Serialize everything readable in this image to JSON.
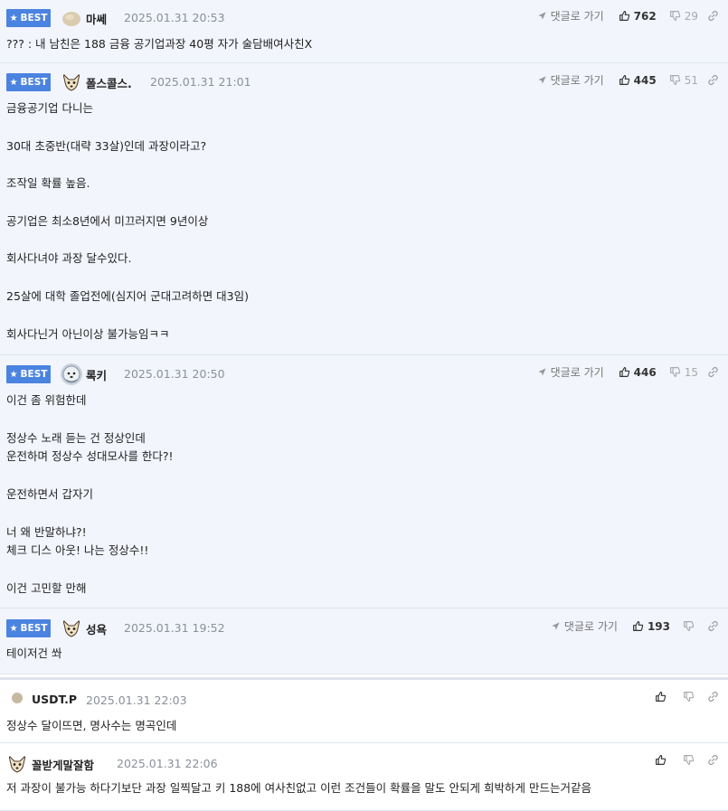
{
  "best_label": "BEST",
  "reply_label": "댓글로 가기",
  "comments": [
    {
      "best": true,
      "nickname": "마쎄",
      "date": "2025.01.31 20:53",
      "likes": "762",
      "dislikes": "29",
      "avatar": "beige-blob",
      "lines": [
        "??? : 내 남친은 188 금융 공기업과장 40평 자가 술담배여사친X"
      ]
    },
    {
      "best": true,
      "nickname": "폴스콜스.",
      "date": "2025.01.31 21:01",
      "likes": "445",
      "dislikes": "51",
      "avatar": "chihuahua",
      "lines": [
        "금융공기업 다니는",
        "",
        "30대 초중반(대략 33살)인데 과장이라고?",
        "",
        "조작일 확률 높음.",
        "",
        "공기업은 최소8년에서 미끄러지면 9년이상",
        "",
        "회사다녀야 과장 달수있다.",
        "",
        "25살에 대학 졸업전에(심지어 군대고려하면 대3임)",
        "",
        "회사다닌거 아닌이상 불가능임ㅋㅋ"
      ]
    },
    {
      "best": true,
      "nickname": "록키",
      "date": "2025.01.31 20:50",
      "likes": "446",
      "dislikes": "15",
      "avatar": "fluffy-dog",
      "lines": [
        "이건 좀 위험한데",
        "",
        "정상수 노래 듣는 건 정상인데",
        "운전하며 정상수 성대모사를 한다?!",
        "",
        "운전하면서 갑자기",
        "",
        "너 왜 반말하냐?!",
        "체크 디스 아웃! 나는 정상수!!",
        "",
        "이건 고민할 만해"
      ]
    },
    {
      "best": true,
      "nickname": "성욕",
      "date": "2025.01.31 19:52",
      "likes": "193",
      "dislikes": "",
      "avatar": "chihuahua",
      "lines": [
        "테이저건 쏴"
      ]
    },
    {
      "best": false,
      "nickname": "USDT.P",
      "date": "2025.01.31 22:03",
      "likes": "",
      "dislikes": "",
      "avatar": "beige-dot",
      "lines": [
        "정상수 달이뜨면, 명사수는 명곡인데"
      ]
    },
    {
      "best": false,
      "nickname": "꼴받게말잘함",
      "date": "2025.01.31 22:06",
      "likes": "",
      "dislikes": "",
      "avatar": "chihuahua",
      "lines": [
        "저 과장이 불가능 하다기보단 과장 일찍달고 키 188에 여사친없고 이런 조건들이 확률을 말도 안되게 희박하게 만드는거같음"
      ]
    }
  ],
  "icons": {
    "badge": "star-icon",
    "reply": "send-arrow-icon",
    "like": "thumbs-up-icon",
    "dislike": "thumbs-down-icon",
    "share": "link-icon"
  },
  "colors": {
    "best_bg": "#f2f5fc",
    "badge": "#4b83e0",
    "divider": "#dde3ee"
  }
}
